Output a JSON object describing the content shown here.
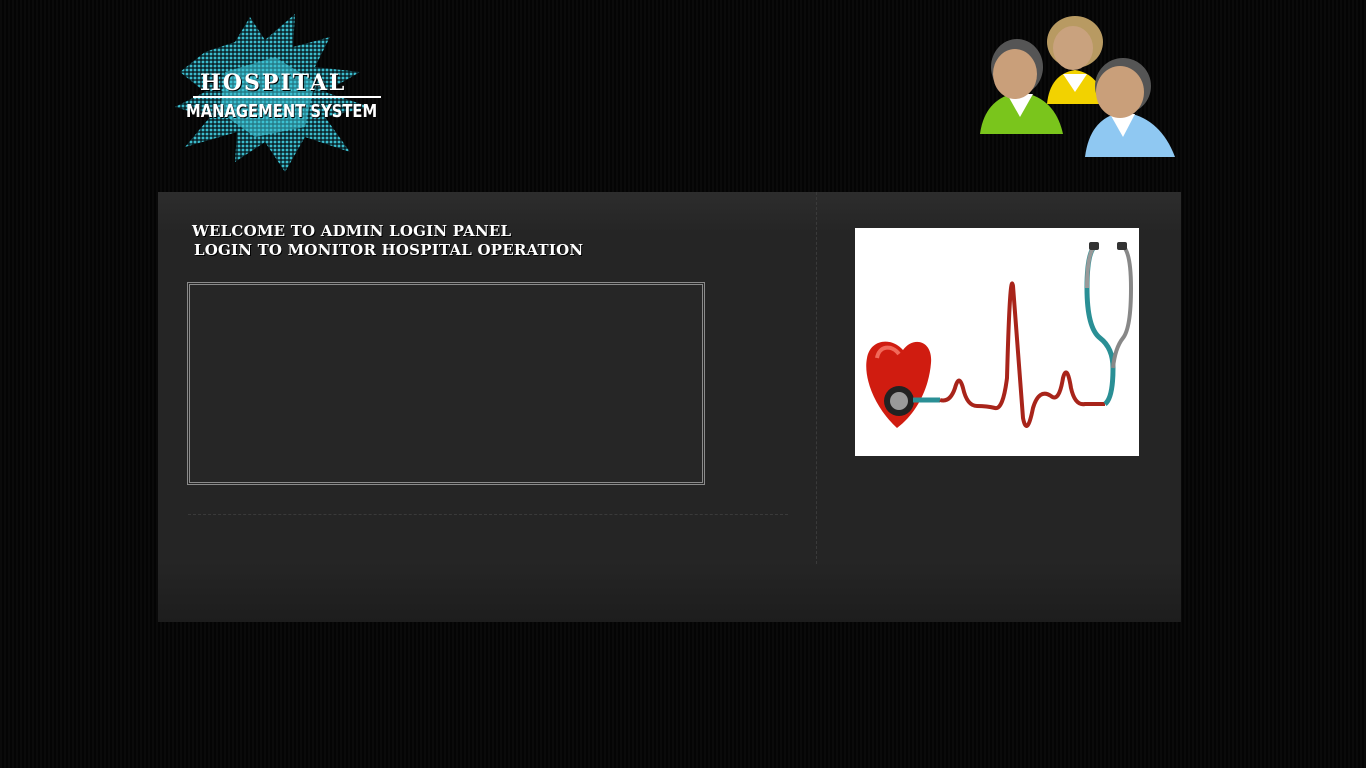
{
  "header": {
    "logo_line1": "HOSPITAL",
    "logo_line2": "MANAGEMENT SYSTEM",
    "logo_icon": "splash-logo-icon",
    "people_icon": "users-group-icon"
  },
  "panel": {
    "welcome_line1": "WELCOME TO ADMIN LOGIN PANEL",
    "welcome_line2": "LOGIN TO MONITOR HOSPITAL OPERATION",
    "side_image_icon": "heart-stethoscope-ecg-image"
  },
  "colors": {
    "background": "#050505",
    "panel": "#252525",
    "logo_splash": "#3ec6d8",
    "text": "#ffffff",
    "heart_red": "#d01c10",
    "stethoscope_teal": "#2a8f95"
  }
}
